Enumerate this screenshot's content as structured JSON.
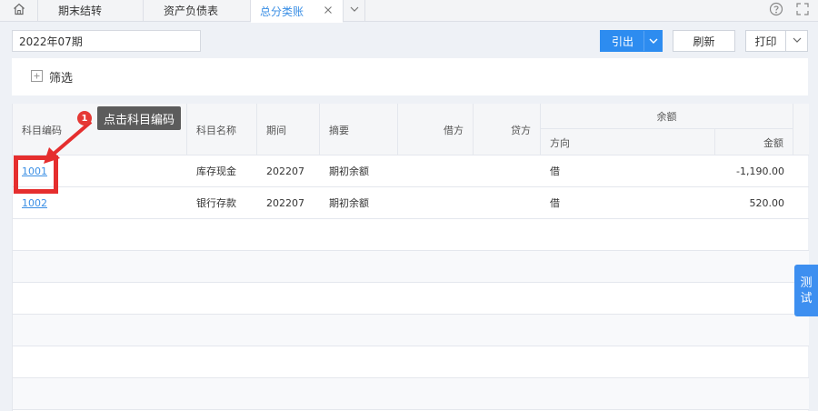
{
  "tabs": {
    "items": [
      {
        "label": "期末结转"
      },
      {
        "label": "资产负债表"
      },
      {
        "label": "总分类账"
      }
    ]
  },
  "toolbar": {
    "period_value": "2022年07期",
    "export_label": "引出",
    "refresh_label": "刷新",
    "print_label": "打印"
  },
  "filter": {
    "label": "筛选"
  },
  "table": {
    "headers": {
      "code": "科目编码",
      "name": "科目名称",
      "period": "期间",
      "summary": "摘要",
      "debit": "借方",
      "credit": "贷方",
      "balance": "余额",
      "direction": "方向",
      "amount": "金额"
    },
    "rows": [
      {
        "code": "1001",
        "name": "库存现金",
        "period": "202207",
        "summary": "期初余额",
        "debit": "",
        "credit": "",
        "direction": "借",
        "amount": "-1,190.00"
      },
      {
        "code": "1002",
        "name": "银行存款",
        "period": "202207",
        "summary": "期初余额",
        "debit": "",
        "credit": "",
        "direction": "借",
        "amount": "520.00"
      }
    ]
  },
  "annotation": {
    "step_number": "1",
    "callout_text": "点击科目编码"
  },
  "side_tab": {
    "line1": "测",
    "line2": "试"
  },
  "colors": {
    "accent": "#2d8cf0",
    "link": "#3b8fe5",
    "highlight": "#e52e2e",
    "callout_bg": "#5c5c5c"
  },
  "icons": [
    "home-icon",
    "close-icon",
    "chevron-down-icon",
    "help-icon",
    "fullscreen-icon",
    "plus-square-icon",
    "arrow-pointer-icon"
  ]
}
